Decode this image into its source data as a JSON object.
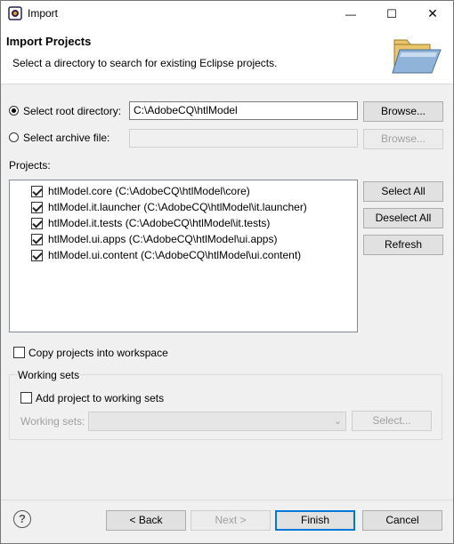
{
  "window": {
    "title": "Import",
    "minimize_glyph": "—",
    "maximize_glyph": "☐",
    "close_glyph": "✕"
  },
  "header": {
    "title": "Import Projects",
    "description": "Select a directory to search for existing Eclipse projects."
  },
  "source": {
    "root_label": "Select root directory:",
    "root_value": "C:\\AdobeCQ\\htlModel",
    "root_selected": true,
    "archive_label": "Select archive file:",
    "archive_value": "",
    "browse_label": "Browse...",
    "browse_archive_label": "Browse..."
  },
  "projects": {
    "label": "Projects:",
    "items": [
      {
        "label": "htlModel.core (C:\\AdobeCQ\\htlModel\\core)",
        "checked": true
      },
      {
        "label": "htlModel.it.launcher (C:\\AdobeCQ\\htlModel\\it.launcher)",
        "checked": true
      },
      {
        "label": "htlModel.it.tests (C:\\AdobeCQ\\htlModel\\it.tests)",
        "checked": true
      },
      {
        "label": "htlModel.ui.apps (C:\\AdobeCQ\\htlModel\\ui.apps)",
        "checked": true
      },
      {
        "label": "htlModel.ui.content (C:\\AdobeCQ\\htlModel\\ui.content)",
        "checked": true
      }
    ],
    "select_all_label": "Select All",
    "deselect_all_label": "Deselect All",
    "refresh_label": "Refresh"
  },
  "options": {
    "copy_label": "Copy projects into workspace",
    "copy_checked": false
  },
  "working_sets": {
    "group_title": "Working sets",
    "add_label": "Add project to working sets",
    "add_checked": false,
    "sets_label": "Working sets:",
    "sets_value": "",
    "select_label": "Select..."
  },
  "footer": {
    "help_glyph": "?",
    "back_label": "< Back",
    "next_label": "Next >",
    "finish_label": "Finish",
    "cancel_label": "Cancel"
  },
  "icons": {
    "app": "eclipse-icon",
    "banner": "folder-import-icon",
    "help": "help-icon"
  }
}
